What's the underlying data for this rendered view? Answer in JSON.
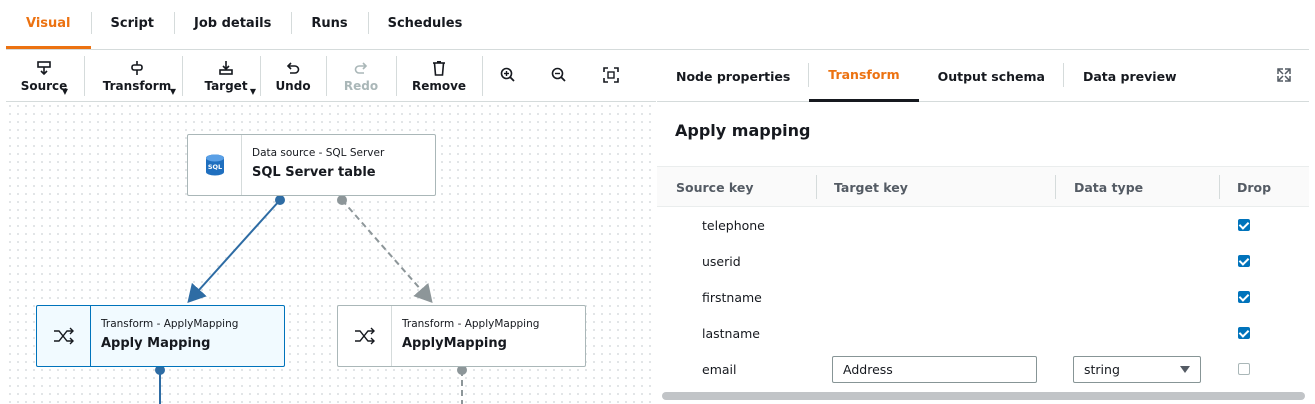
{
  "top_tabs": [
    "Visual",
    "Script",
    "Job details",
    "Runs",
    "Schedules"
  ],
  "toolbar": {
    "source": "Source",
    "transform": "Transform",
    "target": "Target",
    "undo": "Undo",
    "redo": "Redo",
    "remove": "Remove"
  },
  "nodes": {
    "source": {
      "category": "Data source - SQL Server",
      "title": "SQL Server table",
      "icon_text": "SQL"
    },
    "transform1": {
      "category": "Transform - ApplyMapping",
      "title": "Apply Mapping"
    },
    "transform2": {
      "category": "Transform - ApplyMapping",
      "title": "ApplyMapping"
    }
  },
  "right_tabs": [
    "Node properties",
    "Transform",
    "Output schema",
    "Data preview"
  ],
  "section_title": "Apply mapping",
  "table": {
    "headers": [
      "Source key",
      "Target key",
      "Data type",
      "Drop"
    ],
    "rows": [
      {
        "source": "telephone",
        "drop": true
      },
      {
        "source": "userid",
        "drop": true
      },
      {
        "source": "firstname",
        "drop": true
      },
      {
        "source": "lastname",
        "drop": true
      },
      {
        "source": "email",
        "target": "Address",
        "type": "string",
        "drop": false
      }
    ]
  },
  "colors": {
    "accent": "#ec7211",
    "link": "#0073bb"
  }
}
